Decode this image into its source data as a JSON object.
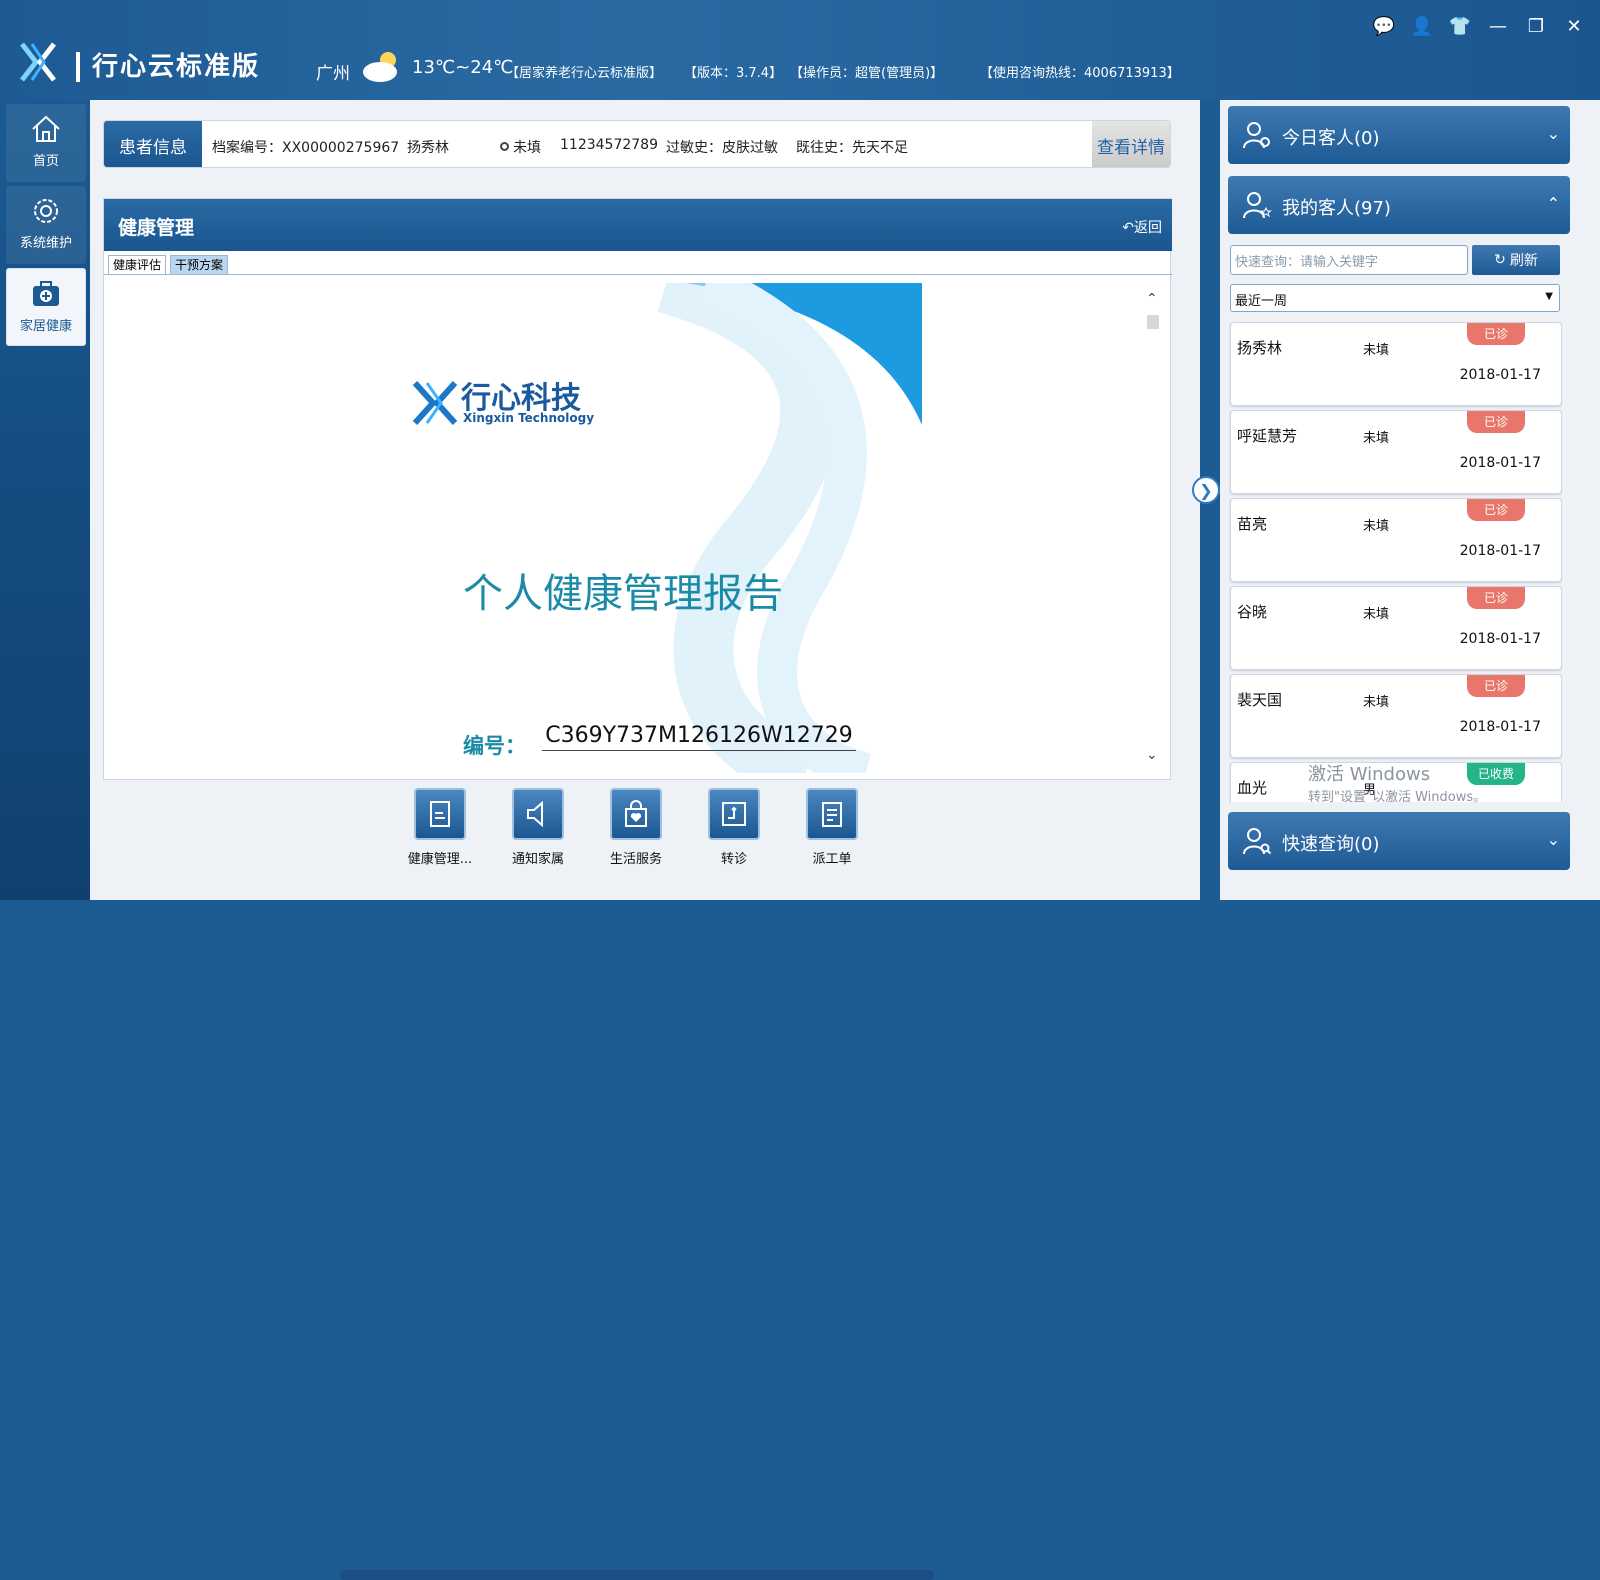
{
  "titlebar": {
    "app_title": "行心云标准版",
    "city": "广州",
    "temperature": "13℃~24℃",
    "edition": "【居家养老行心云标准版】",
    "version": "【版本：3.7.4】",
    "operator": "【操作员：超管(管理员)】",
    "hotline": "【使用咨询热线：4006713913】"
  },
  "nav": [
    {
      "label": "首页",
      "icon": "home-icon"
    },
    {
      "label": "系统维护",
      "icon": "gear-icon"
    },
    {
      "label": "家居健康",
      "icon": "medical-kit-icon"
    }
  ],
  "patient": {
    "tag": "患者信息",
    "file_no": "档案编号：XX00000275967",
    "name": "扬秀林",
    "gender": "未填",
    "phone": "11234572789",
    "allergy": "过敏史：皮肤过敏",
    "history": "既往史：先天不足",
    "detail_button": "查看详情"
  },
  "panel": {
    "title": "健康管理",
    "back": "返回",
    "tabs": [
      "健康评估",
      "干预方案"
    ]
  },
  "report": {
    "brand_cn": "行心科技",
    "brand_en": "Xingxin Technology",
    "title": "个人健康管理报告",
    "code_label": "编号：",
    "code_value": "C369Y737M126126W12729"
  },
  "toolbar": [
    "健康管理...",
    "通知家属",
    "生活服务",
    "转诊",
    "派工单"
  ],
  "right": {
    "today": "今日客人(0)",
    "mine": "我的客人(97)",
    "search_placeholder": "快速查询：请输入关键字",
    "refresh": "刷新",
    "range": "最近一周",
    "quick": "快速查询(0)",
    "customers": [
      {
        "name": "扬秀林",
        "gender": "未填",
        "status": "已诊",
        "date": "2018-01-17"
      },
      {
        "name": "呼延慧芳",
        "gender": "未填",
        "status": "已诊",
        "date": "2018-01-17"
      },
      {
        "name": "苗亮",
        "gender": "未填",
        "status": "已诊",
        "date": "2018-01-17"
      },
      {
        "name": "谷晓",
        "gender": "未填",
        "status": "已诊",
        "date": "2018-01-17"
      },
      {
        "name": "裴天国",
        "gender": "未填",
        "status": "已诊",
        "date": "2018-01-17"
      },
      {
        "name": "血光",
        "gender": "男",
        "status": "已收费",
        "date": ""
      }
    ],
    "watermark1": "激活 Windows",
    "watermark2": "转到\"设置\"以激活 Windows。"
  }
}
